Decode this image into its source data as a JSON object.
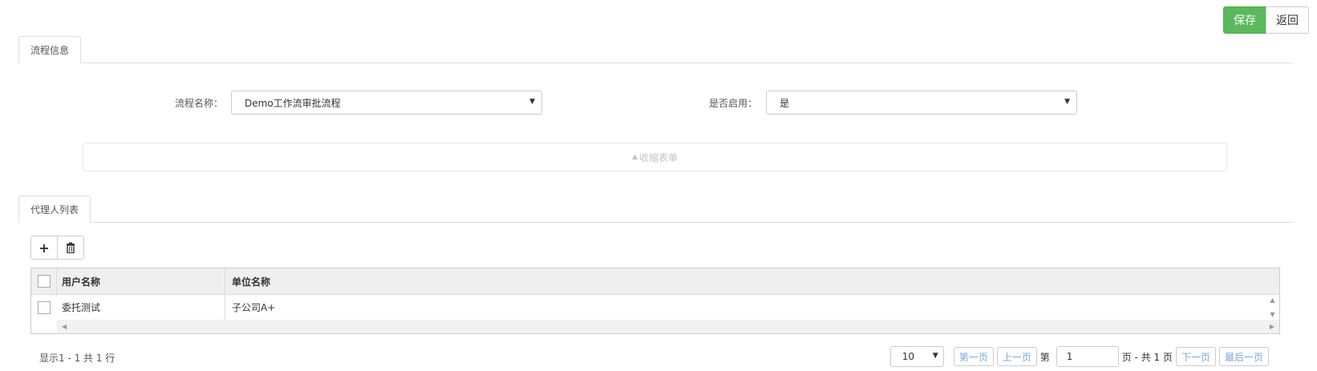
{
  "toolbar": {
    "save_label": "保存",
    "back_label": "返回"
  },
  "tabs": {
    "process_info": "流程信息",
    "agent_list": "代理人列表"
  },
  "form": {
    "process_name_label": "流程名称：",
    "process_name_value": "Demo工作流审批流程",
    "enabled_label": "是否启用：",
    "enabled_value": "是"
  },
  "collapse_label": "收缩表单",
  "grid": {
    "columns": [
      "用户名称",
      "单位名称"
    ],
    "rows": [
      {
        "user": "委托测试",
        "unit": "子公司A+"
      }
    ]
  },
  "pager": {
    "info": "显示1 - 1 共 1 行",
    "page_size": "10",
    "first": "第一页",
    "prev": "上一页",
    "page_prefix": "第",
    "current_page": "1",
    "total_text": "页 - 共 1 页",
    "next": "下一页",
    "last": "最后一页"
  },
  "icons": {
    "add": "plus-icon",
    "delete": "trash-icon"
  },
  "colors": {
    "save": "#5cb85c",
    "link": "#7aa7d6"
  }
}
